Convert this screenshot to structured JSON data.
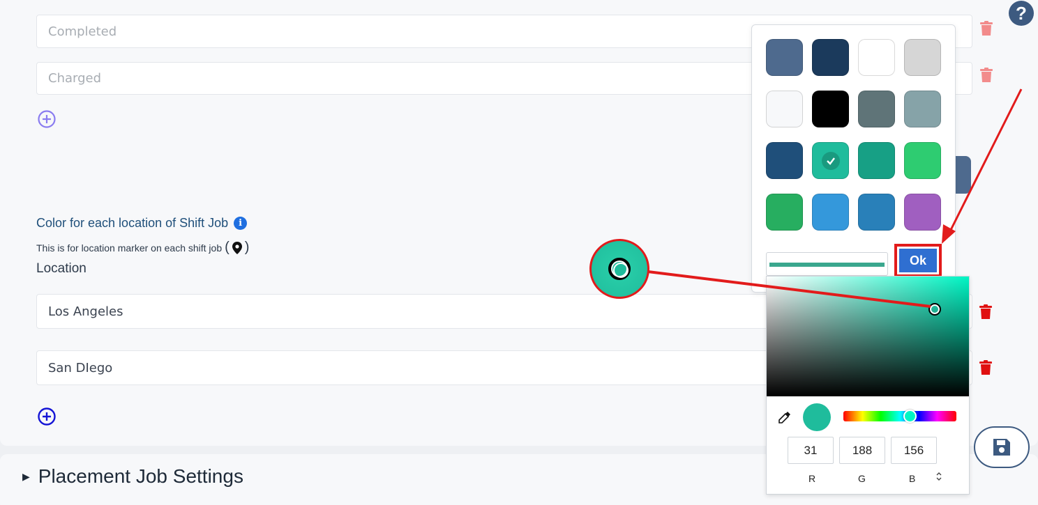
{
  "status_fields": [
    {
      "placeholder": "Completed"
    },
    {
      "placeholder": "Charged"
    }
  ],
  "location_section": {
    "title": "Color for each location of Shift Job",
    "subtext": "This is for location marker on each shift job",
    "paren_open": "(",
    "paren_close": ")",
    "label": "Location",
    "locations": [
      {
        "value": "Los Angeles"
      },
      {
        "value": "San DIego"
      }
    ]
  },
  "help": {
    "label": "?"
  },
  "placement": {
    "label": "Placement Job Settings"
  },
  "color_picker": {
    "swatches": [
      "#4e6a8e",
      "#1b3a5c",
      "#ffffff",
      "#d6d6d6",
      "#f7f8fa",
      "#000000",
      "#5f7478",
      "#86a3a8",
      "#1f4f7a",
      "#1fbc9c",
      "#17a085",
      "#2ecc71",
      "#27ae60",
      "#3498db",
      "#2980b9",
      "#a05fc0"
    ],
    "selected_index": 9,
    "ok_label": "Ok",
    "current_color": "#1fbc9c",
    "rgb": {
      "r": "31",
      "g": "188",
      "b": "156"
    },
    "labels": {
      "r": "R",
      "g": "G",
      "b": "B"
    },
    "mode_toggle": "⌃⌄"
  },
  "icons": {
    "trash": "trash-icon",
    "add": "add-circle-icon",
    "info": "info-icon",
    "pin": "map-pin-icon",
    "save": "save-icon",
    "eyedropper": "eyedropper-icon",
    "caret": "caret-right-icon"
  },
  "colors": {
    "trash_faded": "#f28b8b",
    "trash_active": "#e01010",
    "add_faded": "#8a7cf0",
    "add_active": "#1515d6",
    "title": "#1f4f7a",
    "annotation": "#e21b1b"
  }
}
